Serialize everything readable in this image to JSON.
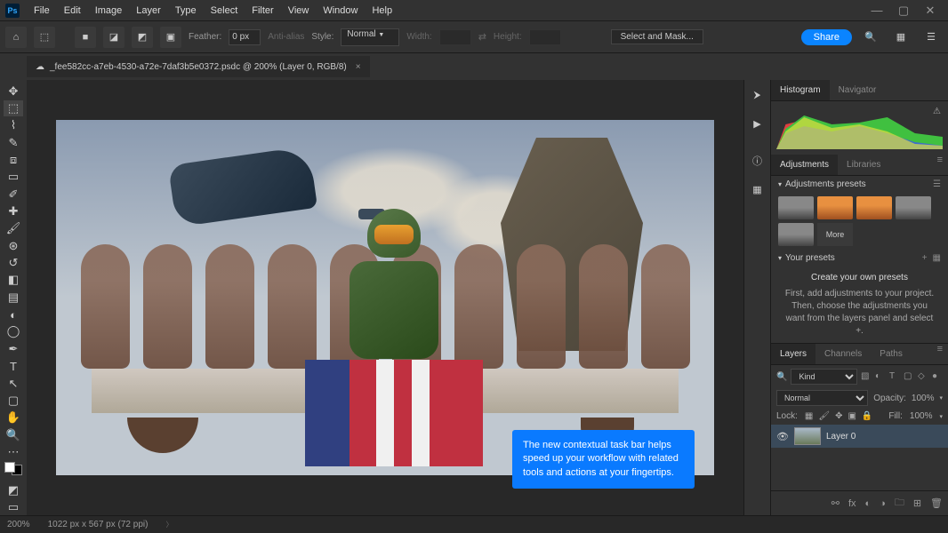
{
  "menubar": {
    "items": [
      "File",
      "Edit",
      "Image",
      "Layer",
      "Type",
      "Select",
      "Filter",
      "View",
      "Window",
      "Help"
    ]
  },
  "optionsbar": {
    "feather_label": "Feather:",
    "feather_value": "0 px",
    "antialias_label": "Anti-alias",
    "style_label": "Style:",
    "style_value": "Normal",
    "width_label": "Width:",
    "height_label": "Height:",
    "select_mask_label": "Select and Mask...",
    "share_label": "Share"
  },
  "document": {
    "tab_label": "_fee582cc-a7eb-4530-a72e-7daf3b5e0372.psdc @ 200% (Layer 0, RGB/8)"
  },
  "tooltip": {
    "text": "The new contextual task bar helps speed up your workflow with related tools and actions at your fingertips."
  },
  "panels": {
    "histogram_tab": "Histogram",
    "navigator_tab": "Navigator",
    "adjustments_tab": "Adjustments",
    "libraries_tab": "Libraries",
    "adj_presets_label": "Adjustments presets",
    "more_label": "More",
    "your_presets_label": "Your presets",
    "own_presets_title": "Create your own presets",
    "own_presets_help": "First, add adjustments to your project. Then, choose the adjustments you want from the layers panel and select  +.",
    "layers_tab": "Layers",
    "channels_tab": "Channels",
    "paths_tab": "Paths",
    "kind_label": "Kind",
    "blend_mode": "Normal",
    "opacity_label": "Opacity:",
    "opacity_value": "100%",
    "lock_label": "Lock:",
    "fill_label": "Fill:",
    "fill_value": "100%",
    "layer0_name": "Layer 0"
  },
  "statusbar": {
    "zoom": "200%",
    "dims": "1022 px x 567 px (72 ppi)"
  }
}
